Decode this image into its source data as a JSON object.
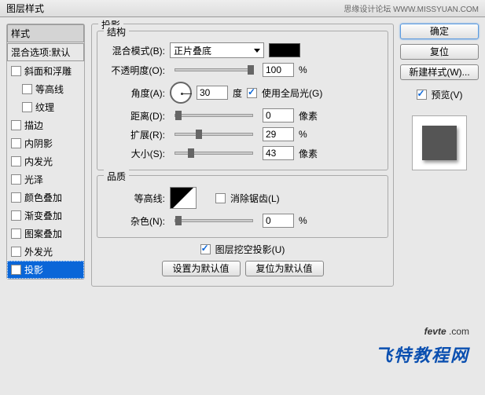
{
  "title": "图层样式",
  "watermark_right": "思缘设计论坛  WWW.MISSYUAN.COM",
  "sidebar": {
    "header_styles": "样式",
    "header_blend": "混合选项:默认",
    "items": [
      {
        "label": "斜面和浮雕",
        "checked": false,
        "indent": false,
        "selected": false
      },
      {
        "label": "等高线",
        "checked": false,
        "indent": true,
        "selected": false
      },
      {
        "label": "纹理",
        "checked": false,
        "indent": true,
        "selected": false
      },
      {
        "label": "描边",
        "checked": false,
        "indent": false,
        "selected": false
      },
      {
        "label": "内阴影",
        "checked": false,
        "indent": false,
        "selected": false
      },
      {
        "label": "内发光",
        "checked": false,
        "indent": false,
        "selected": false
      },
      {
        "label": "光泽",
        "checked": false,
        "indent": false,
        "selected": false
      },
      {
        "label": "颜色叠加",
        "checked": false,
        "indent": false,
        "selected": false
      },
      {
        "label": "渐变叠加",
        "checked": false,
        "indent": false,
        "selected": false
      },
      {
        "label": "图案叠加",
        "checked": false,
        "indent": false,
        "selected": false
      },
      {
        "label": "外发光",
        "checked": false,
        "indent": false,
        "selected": false
      },
      {
        "label": "投影",
        "checked": true,
        "indent": false,
        "selected": true
      }
    ]
  },
  "panel": {
    "title": "投影",
    "structure": "结构",
    "blend_mode_label": "混合模式(B):",
    "blend_mode_value": "正片叠底",
    "opacity_label": "不透明度(O):",
    "opacity_value": "100",
    "percent": "%",
    "angle_label": "角度(A):",
    "angle_value": "30",
    "degree": "度",
    "global_light": "使用全局光(G)",
    "distance_label": "距离(D):",
    "distance_value": "0",
    "spread_label": "扩展(R):",
    "spread_value": "29",
    "size_label": "大小(S):",
    "size_value": "43",
    "px": "像素",
    "quality": "品质",
    "contour_label": "等高线:",
    "antialias": "消除锯齿(L)",
    "noise_label": "杂色(N):",
    "noise_value": "0",
    "knockout": "图层挖空投影(U)",
    "make_default": "设置为默认值",
    "reset_default": "复位为默认值"
  },
  "buttons": {
    "ok": "确定",
    "cancel": "复位",
    "new_style": "新建样式(W)...",
    "preview": "预览(V)"
  },
  "wm1a": "fevte",
  "wm1b": " .com",
  "wm2": "飞特教程网"
}
